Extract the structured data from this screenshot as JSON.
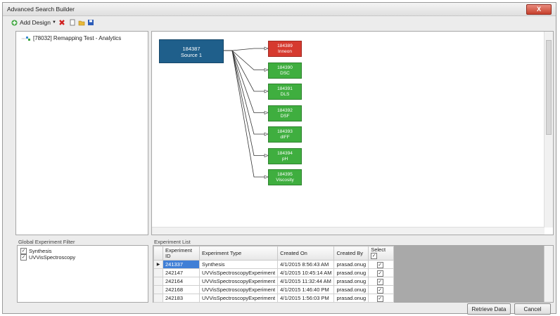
{
  "window": {
    "title": "Advanced Search Builder",
    "close_label": "X"
  },
  "toolbar": {
    "add_design_label": "Add Design",
    "add_icon": "plus-icon",
    "delete_icon": "red-x-icon",
    "new_icon": "new-document-icon",
    "open_icon": "folder-open-icon",
    "save_icon": "floppy-disk-icon"
  },
  "tree": {
    "root_label": "[78032] Remapping Test - Analytics"
  },
  "diagram": {
    "source": {
      "id": "184387",
      "name": "Source 1",
      "color": "#1f5f8b"
    },
    "targets": [
      {
        "id": "184389",
        "name": "Inneon",
        "color": "#d63a2f"
      },
      {
        "id": "184390",
        "name": "DSC",
        "color": "#3fae3f"
      },
      {
        "id": "184391",
        "name": "DLS",
        "color": "#3fae3f"
      },
      {
        "id": "184392",
        "name": "DSF",
        "color": "#3fae3f"
      },
      {
        "id": "184393",
        "name": "dIFF",
        "color": "#3fae3f"
      },
      {
        "id": "184394",
        "name": "pH",
        "color": "#3fae3f"
      },
      {
        "id": "184395",
        "name": "Viscosity",
        "color": "#3fae3f"
      }
    ]
  },
  "filter": {
    "label": "Global Experiment Filter",
    "items": [
      {
        "label": "Synthesis",
        "checked": true
      },
      {
        "label": "UVVisSpectroscopy",
        "checked": true
      }
    ]
  },
  "experiments": {
    "label": "Experiment List",
    "columns": [
      "Experiment ID",
      "Experiment Type",
      "Created On",
      "Created By",
      "Select"
    ],
    "rows": [
      {
        "id": "241337",
        "type": "Synthesis",
        "created_on": "4/1/2015 8:56:43 AM",
        "created_by": "prasad.onug",
        "selected": true
      },
      {
        "id": "242147",
        "type": "UVVisSpectroscopyExperiment",
        "created_on": "4/1/2015 10:45:14 AM",
        "created_by": "prasad.onug",
        "selected": true
      },
      {
        "id": "242164",
        "type": "UVVisSpectroscopyExperiment",
        "created_on": "4/1/2015 11:32:44 AM",
        "created_by": "prasad.onug",
        "selected": true
      },
      {
        "id": "242168",
        "type": "UVVisSpectroscopyExperiment",
        "created_on": "4/1/2015 1:46:40 PM",
        "created_by": "prasad.onug",
        "selected": true
      },
      {
        "id": "242183",
        "type": "UVVisSpectroscopyExperiment",
        "created_on": "4/1/2015 1:56:03 PM",
        "created_by": "prasad.onug",
        "selected": true
      }
    ]
  },
  "buttons": {
    "retrieve": "Retrieve Data",
    "cancel": "Cancel"
  }
}
